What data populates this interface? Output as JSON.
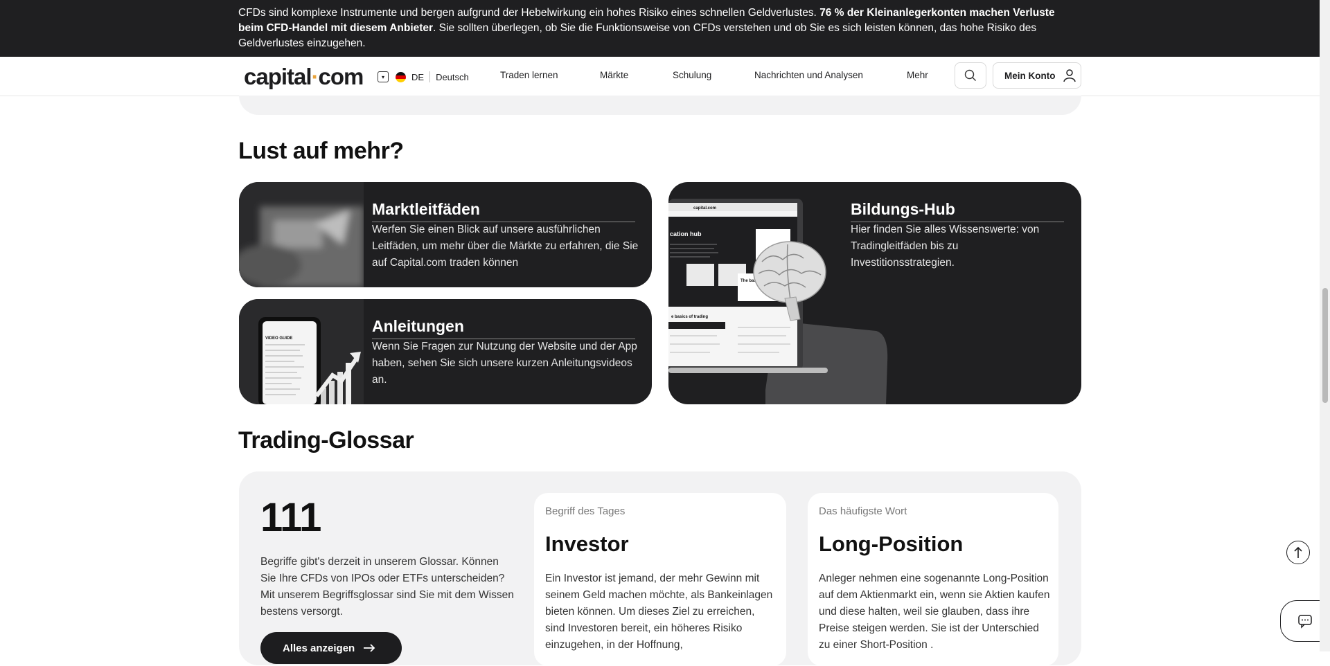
{
  "risk_banner": {
    "text_before": "CFDs sind komplexe Instrumente und bergen aufgrund der Hebelwirkung ein hohes Risiko eines schnellen Geldverlustes. ",
    "text_bold": "76 % der Kleinanlegerkonten machen Verluste beim CFD-Handel mit diesem Anbieter",
    "text_after": ". Sie sollten überlegen, ob Sie die Funktionsweise von CFDs verstehen und ob Sie es sich leisten können, das hohe Risiko des Geldverlustes einzugehen."
  },
  "header": {
    "logo_left": "capital",
    "logo_dot": "·",
    "logo_right": "com",
    "lang_code": "DE",
    "lang_name": "Deutsch",
    "nav": [
      "Traden lernen",
      "Märkte",
      "Schulung",
      "Nachrichten und Analysen",
      "Mehr"
    ],
    "account_label": "Mein Konto"
  },
  "more_section": {
    "heading": "Lust auf mehr?",
    "cards": [
      {
        "title": "Marktleitfäden",
        "text": "Werfen Sie einen Blick auf unsere ausführlichen Leitfäden, um mehr über die Märkte zu erfahren, die Sie auf Capital.com traden können"
      },
      {
        "title": "Anleitungen",
        "text": "Wenn Sie Fragen zur Nutzung der Website und der App haben, sehen Sie sich unsere kurzen Anleitungsvideos an."
      },
      {
        "title": "Bildungs-Hub",
        "text": "Hier finden Sie alles Wissenswerte: von Tradingleitfäden bis zu Investitionsstrategien."
      }
    ],
    "laptop_screen": {
      "site_label": "capital.com",
      "hub_label": "cation hub",
      "basics_label": "e basics of trading",
      "card_label": "The basics in 7 short",
      "video_guide": "VIDEO GUIDE"
    }
  },
  "glossary": {
    "heading": "Trading-Glossar",
    "count": "111",
    "description": "Begriffe gibt's derzeit in unserem Glossar. Können Sie Ihre CFDs von IPOs oder ETFs unterscheiden? Mit unserem Begriffsglossar sind Sie mit dem Wissen bestens versorgt.",
    "button_label": "Alles anzeigen",
    "term_of_day": {
      "kicker": "Begriff des Tages",
      "title": "Investor",
      "text": "Ein Investor ist jemand, der mehr Gewinn mit seinem Geld machen möchte, als Bankeinlagen bieten können. Um dieses Ziel zu erreichen, sind Investoren bereit, ein höheres Risiko einzugehen, in der Hoffnung,"
    },
    "most_frequent": {
      "kicker": "Das häufigste Wort",
      "title": "Long-Position",
      "text": "Anleger nehmen eine sogenannte Long-Position auf dem Aktienmarkt ein, wenn sie Aktien kaufen und diese halten, weil sie glauben, dass ihre Preise steigen werden. Sie ist der Unterschied zu einer Short-Position ."
    }
  },
  "icons": {
    "search": "search-icon",
    "user": "user-icon",
    "arrow_up": "arrow-up-icon",
    "chat": "chat-icon",
    "arrow_right": "arrow-right-icon"
  },
  "colors": {
    "banner_bg": "#1f1f21",
    "card_bg": "#1f1f21",
    "logo_dot": "#e8a33c",
    "section_bg": "#f2f2f3"
  }
}
